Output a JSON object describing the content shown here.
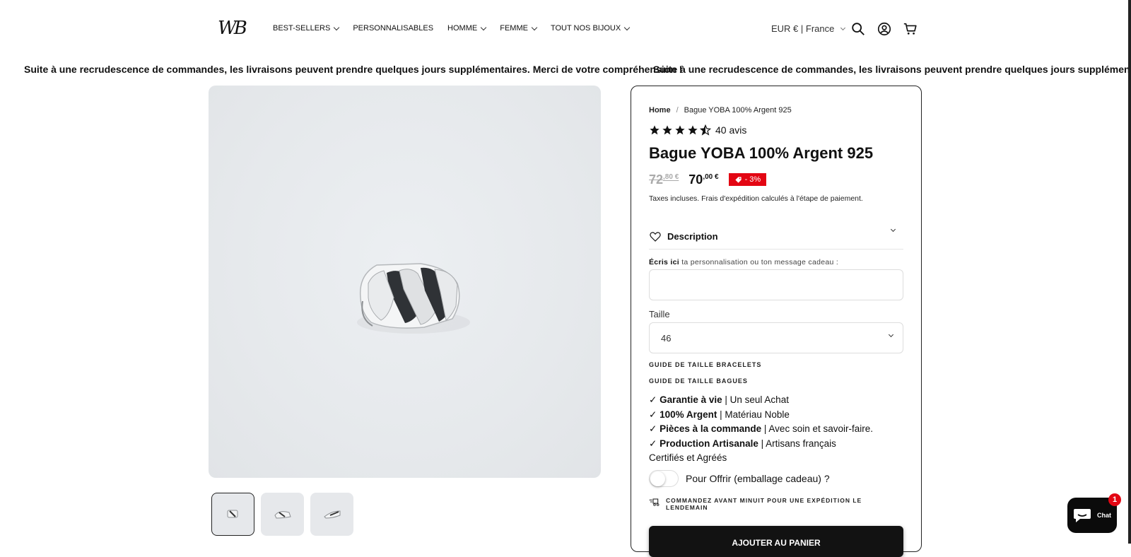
{
  "header": {
    "logo_text": "WB",
    "nav": [
      {
        "label": "BEST-SELLERS",
        "has_dropdown": true
      },
      {
        "label": "PERSONNALISABLES",
        "has_dropdown": false
      },
      {
        "label": "HOMME",
        "has_dropdown": true
      },
      {
        "label": "FEMME",
        "has_dropdown": true
      },
      {
        "label": "TOUT NOS BIJOUX",
        "has_dropdown": true
      }
    ],
    "currency": "EUR € | France",
    "icons": [
      "search-icon",
      "account-icon",
      "cart-icon"
    ]
  },
  "announcement": {
    "text": "Suite à une recrudescence de commandes, les livraisons peuvent prendre quelques jours supplémentaires. Merci de votre compréhension !"
  },
  "gallery": {
    "thumbnails": [
      "ring-view-1",
      "ring-view-2",
      "ring-view-3"
    ],
    "active_thumbnail": 1
  },
  "product": {
    "breadcrumb": {
      "home": "Home",
      "sep": "/",
      "current": "Bague YOBA 100% Argent 925"
    },
    "rating": {
      "stars": 4.5,
      "reviews_label": "40 avis"
    },
    "title": "Bague YOBA 100% Argent 925",
    "old_price": {
      "main": "72",
      "cents": ",80 €"
    },
    "new_price": {
      "main": "70",
      "cents": ",00 €"
    },
    "discount_badge": "- 3%",
    "tax_note": "Taxes incluses. Frais d'expédition calculés à l'étape de paiement.",
    "description_label": "Description",
    "custom_label_bold": "Écris ici",
    "custom_label_rest": " ta personnalisation ou ton message cadeau :",
    "custom_input_value": "",
    "size_label": "Taille",
    "size_value": "46",
    "guide_bracelets": "GUIDE DE TAILLE BRACELETS",
    "guide_bagues": "GUIDE DE TAILLE BAGUES",
    "features": [
      {
        "check": "✓",
        "bold": "Garantie à vie",
        "rest": " | Un seul Achat"
      },
      {
        "check": "✓",
        "bold": "100% Argent",
        "rest": " | Matériau Noble"
      },
      {
        "check": "✓",
        "bold": "Pièces à la commande",
        "rest": " | Avec soin et savoir-faire."
      },
      {
        "check": "✓",
        "bold": "Production Artisanale",
        "rest": " | Artisans français Certifiés et Agréés"
      }
    ],
    "gift_toggle_label": "Pour Offrir (emballage cadeau) ?",
    "gift_toggle_on": false,
    "shipping_note": "COMMANDEZ AVANT MINUIT POUR UNE EXPÉDITION LE LENDEMAIN",
    "add_to_cart": "AJOUTER AU PANIER"
  },
  "chat": {
    "label": "Chat",
    "badge": "1"
  },
  "colors": {
    "sale_red": "#e30613",
    "button_black": "#121212",
    "strike_gray": "#aaaaaa"
  }
}
